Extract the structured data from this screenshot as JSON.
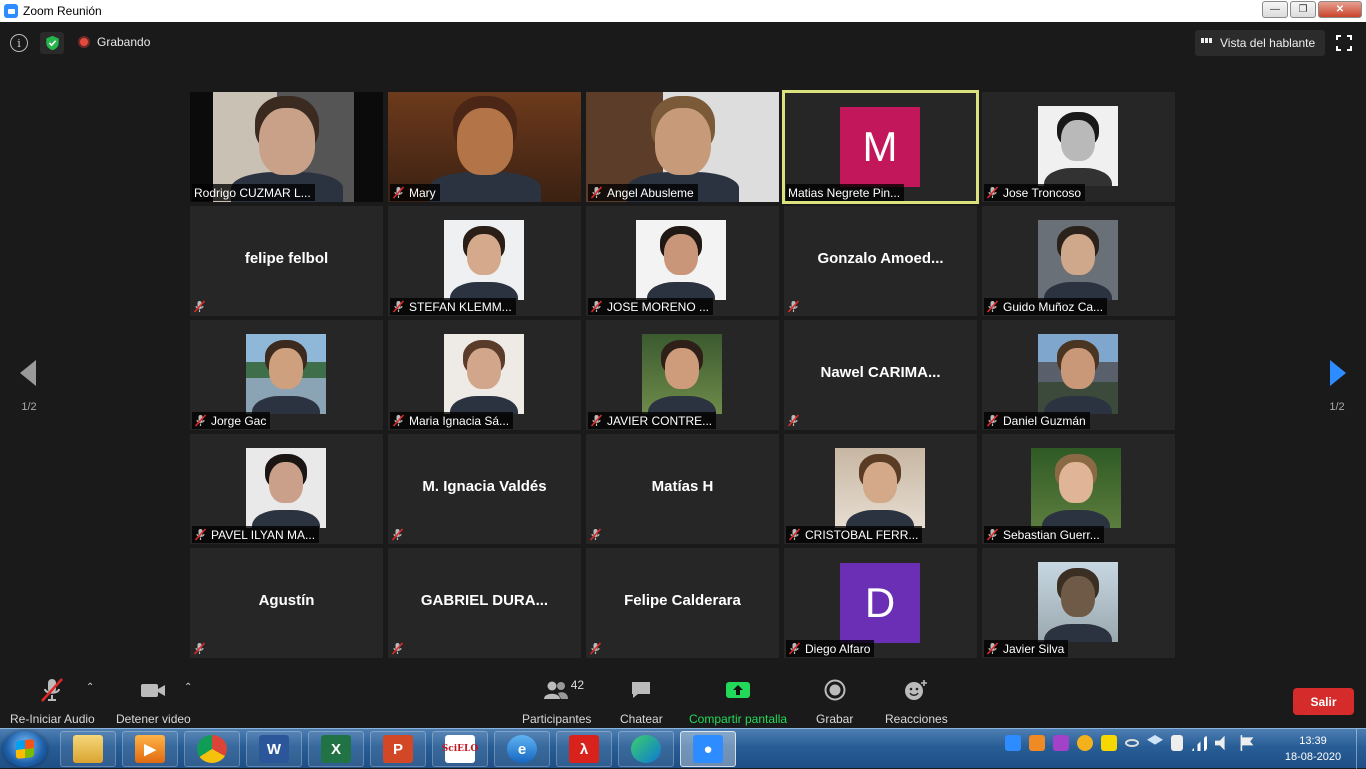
{
  "window": {
    "title": "Zoom Reunión"
  },
  "topbar": {
    "recording_label": "Grabando",
    "view_label": "Vista del hablante"
  },
  "participants": [
    {
      "name": "Rodrigo CUZMAR L...",
      "type": "video",
      "muted": false
    },
    {
      "name": "Mary",
      "type": "video",
      "muted": true
    },
    {
      "name": "Angel Abusleme",
      "type": "video",
      "muted": true
    },
    {
      "name": "Matias Negrete Pin...",
      "type": "avatar",
      "letter": "M",
      "avatar_color": "#c2185b",
      "muted": false,
      "active_speaker": true
    },
    {
      "name": "Jose Troncoso",
      "type": "video",
      "muted": true
    },
    {
      "name": "felipe felbol",
      "type": "name",
      "muted": true
    },
    {
      "name": "STEFAN KLEMM...",
      "type": "video",
      "muted": true
    },
    {
      "name": "JOSE MORENO ...",
      "type": "video",
      "muted": true
    },
    {
      "name": "Gonzalo  Amoed...",
      "type": "name",
      "muted": true
    },
    {
      "name": "Guido Muñoz Ca...",
      "type": "video",
      "muted": true
    },
    {
      "name": "Jorge Gac",
      "type": "video",
      "muted": true
    },
    {
      "name": "Maria Ignacia Sá...",
      "type": "video",
      "muted": true
    },
    {
      "name": "JAVIER CONTRE...",
      "type": "video",
      "muted": true
    },
    {
      "name": "Nawel  CARIMA...",
      "type": "name",
      "muted": true
    },
    {
      "name": "Daniel Guzmán",
      "type": "video",
      "muted": true
    },
    {
      "name": "PAVEL ILYAN MA...",
      "type": "video",
      "muted": true
    },
    {
      "name": "M. Ignacia Valdés",
      "type": "name",
      "muted": true
    },
    {
      "name": "Matías H",
      "type": "name",
      "muted": true
    },
    {
      "name": "CRISTOBAL FERR...",
      "type": "video",
      "muted": true
    },
    {
      "name": "Sebastian Guerr...",
      "type": "video",
      "muted": true
    },
    {
      "name": "Agustín",
      "type": "name",
      "muted": true
    },
    {
      "name": "GABRIEL DURA...",
      "type": "name",
      "muted": true
    },
    {
      "name": "Felipe Calderara",
      "type": "name",
      "muted": true
    },
    {
      "name": "Diego Alfaro",
      "type": "avatar",
      "letter": "D",
      "avatar_color": "#6a2fb5",
      "muted": true
    },
    {
      "name": "Javier Silva",
      "type": "video",
      "muted": true
    }
  ],
  "pagination": {
    "left": "1/2",
    "right": "1/2"
  },
  "toolbar": {
    "audio_label": "Re-Iniciar Audio",
    "video_label": "Detener video",
    "participants_label": "Participantes",
    "participants_count": "42",
    "chat_label": "Chatear",
    "share_label": "Compartir pantalla",
    "record_label": "Grabar",
    "reactions_label": "Reacciones",
    "leave_label": "Salir",
    "share_color": "#23d959",
    "leave_color": "#d52b2b"
  },
  "taskbar": {
    "apps": [
      "explorer-icon",
      "media-player-icon",
      "chrome-icon",
      "word-icon",
      "excel-icon",
      "powerpoint-icon",
      "scielo-icon",
      "internet-explorer-icon",
      "acrobat-icon",
      "edge-icon",
      "zoom-icon"
    ],
    "scielo_text": "SciELO",
    "time": "13:39",
    "date": "18-08-2020"
  }
}
